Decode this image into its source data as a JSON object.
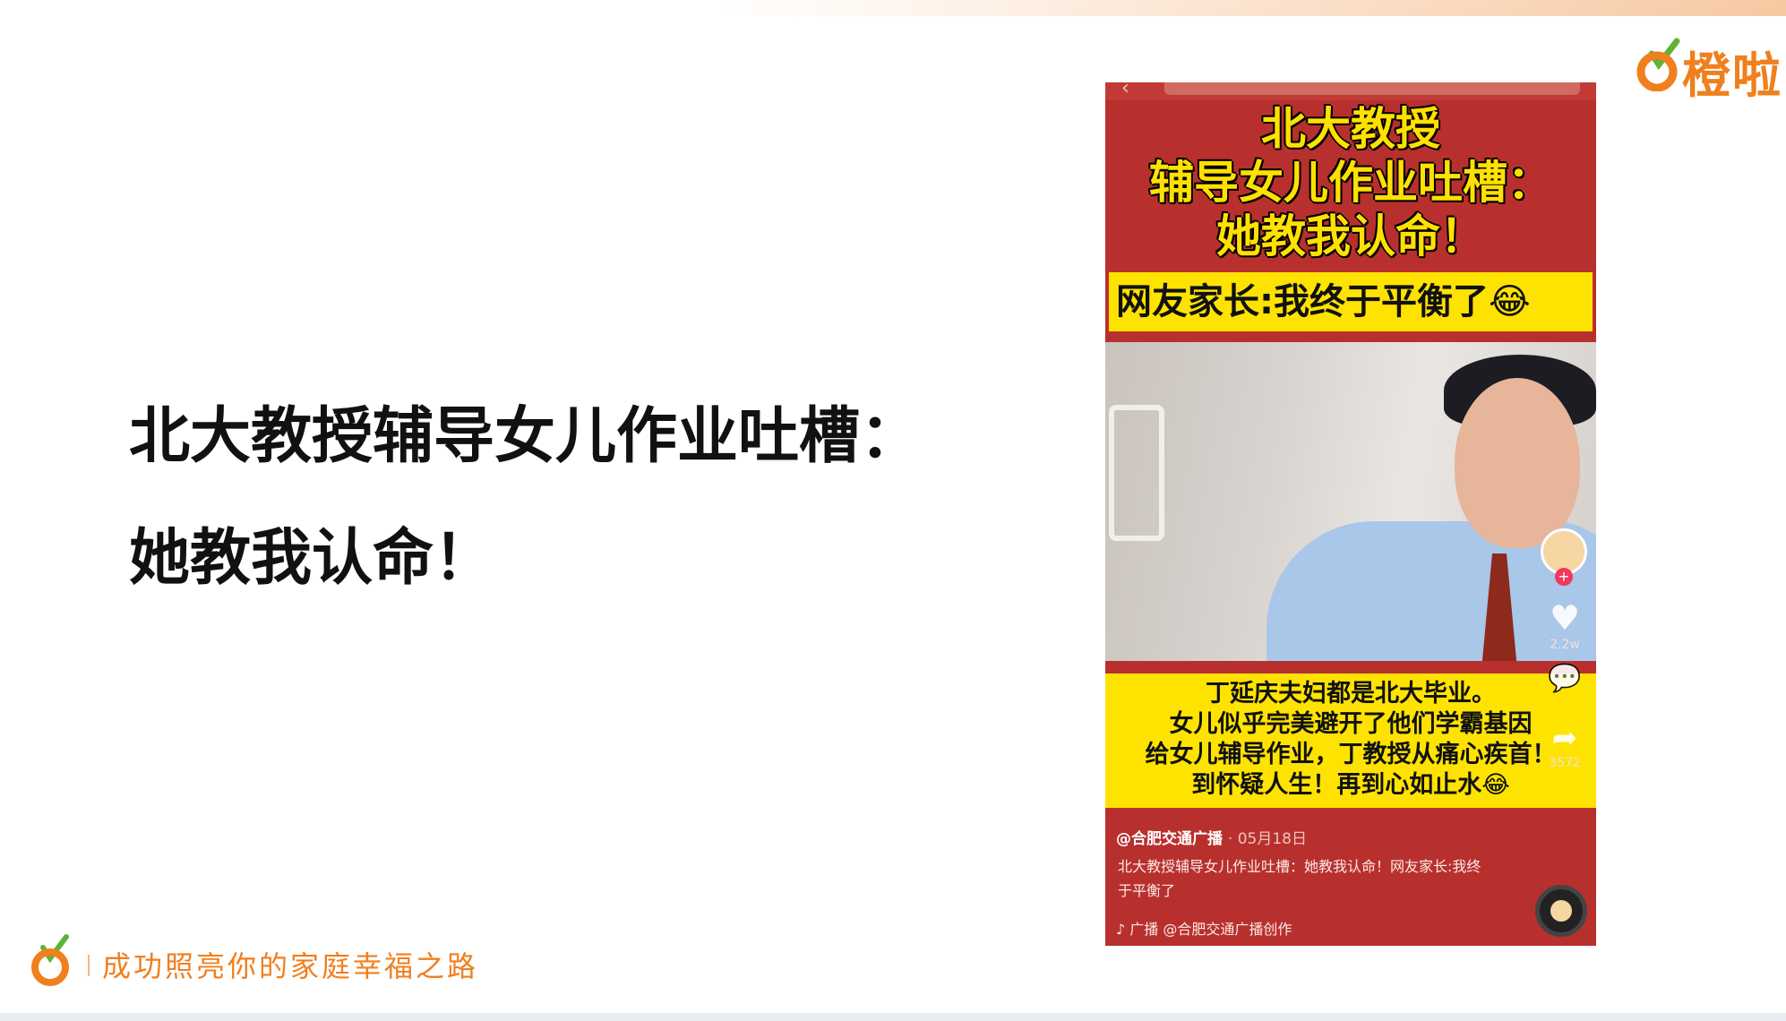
{
  "brand": {
    "name": "橙啦",
    "accent": "#f07f1e"
  },
  "headline": {
    "line1": "北大教授辅导女儿作业吐槽：",
    "line2": "她教我认命！"
  },
  "footer": {
    "slogan": "成功照亮你的家庭幸福之路"
  },
  "phone": {
    "cover_title_1": "北大教授",
    "cover_title_2": "辅导女儿作业吐槽：",
    "cover_title_3": "她教我认命！",
    "cover_sub": "网友家长:我终于平衡了😂",
    "caption_1": "丁延庆夫妇都是北大毕业。",
    "caption_2": "女儿似乎完美避开了他们学霸基因",
    "caption_3": "给女儿辅导作业，丁教授从痛心疾首！",
    "caption_4": "到怀疑人生！再到心如止水😂",
    "likes": "2.2w",
    "shares": "3572",
    "author": "@合肥交通广播",
    "date": "· 05月18日",
    "description": "北大教授辅导女儿作业吐槽：她教我认命！网友家长:我终于平衡了",
    "music": "广播 @合肥交通广播创作",
    "icons": [
      "back-arrow-icon",
      "heart-icon",
      "comment-icon",
      "share-icon",
      "music-disc-icon",
      "tiktok-note-icon"
    ]
  }
}
